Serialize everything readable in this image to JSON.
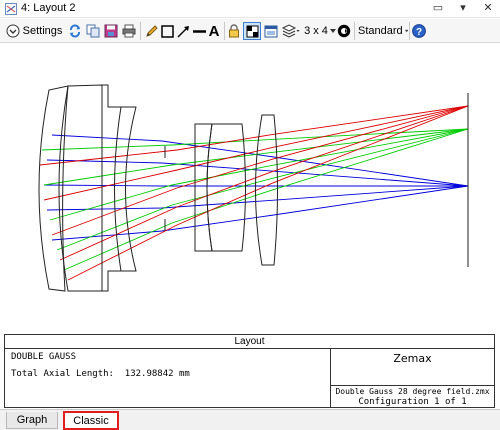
{
  "window": {
    "title": "4: Layout 2"
  },
  "toolbar": {
    "settings_label": "Settings",
    "grid_label": "3 x 4",
    "standard_label": "Standard"
  },
  "panel": {
    "title": "Layout",
    "system_name": "DOUBLE GAUSS",
    "axial_length": "Total Axial Length:  132.98842 mm",
    "brand": "Zemax",
    "file": "Double Gauss 28 degree field.zmx",
    "configuration": "Configuration 1 of 1"
  },
  "tabs": [
    {
      "label": "Graph"
    },
    {
      "label": "Classic"
    }
  ],
  "colors": {
    "field1": "#dd0000",
    "field2": "#00cc00",
    "field3": "#0000dd",
    "highlight": "#e02020"
  }
}
